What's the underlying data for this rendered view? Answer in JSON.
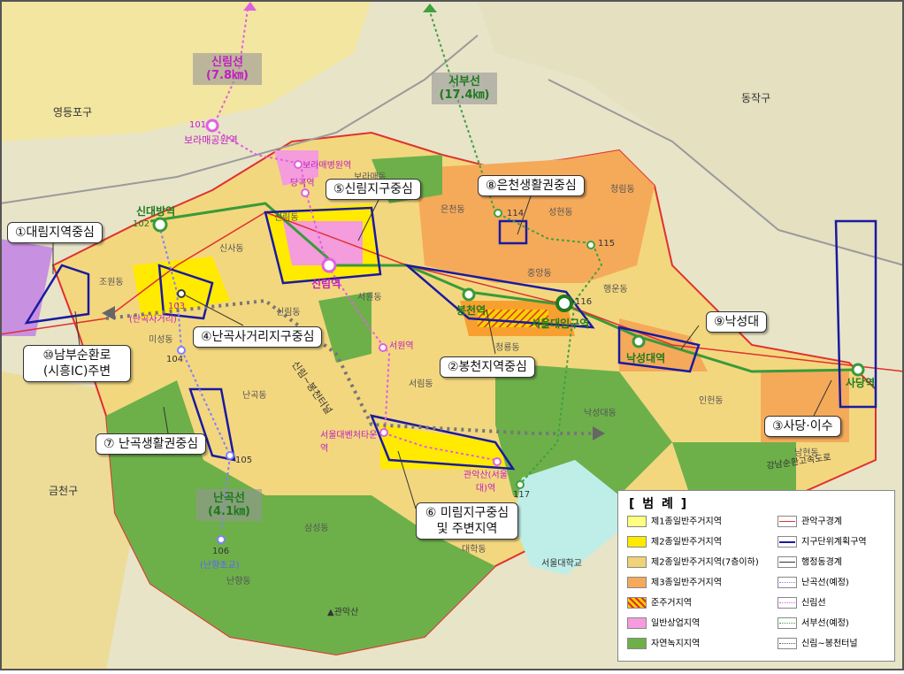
{
  "districts": {
    "yeongdeungpo": "영등포구",
    "dongjak": "동작구",
    "geumcheon": "금천구"
  },
  "neighborhoods": {
    "jowon": "조원동",
    "sinsa": "신사동",
    "sillim": "신림동",
    "seowon": "서원동",
    "misung": "미성동",
    "nangok": "난곡동",
    "seorim": "서림동",
    "nanhyang": "난향동",
    "samseong": "삼성동",
    "daehak": "대학동",
    "euncheon": "은천동",
    "seonghyeon": "성현동",
    "cheongrim": "청림동",
    "jungang": "중앙동",
    "haengun": "행운동",
    "cheongryong": "청룡동",
    "nakseongdae": "낙성대동",
    "inheon": "인헌동",
    "namhyeon": "남현동",
    "boramae": "보라매동"
  },
  "stations": {
    "sindaebang": "신대방역",
    "sillim": "신림역",
    "bongcheon": "봉천역",
    "snu": "서울대입구역",
    "nakseongdae": "낙성대역",
    "sadang": "사당역",
    "boramae_park": "보라매공원역",
    "boramae_hospital": "보라매병원역",
    "dang": "당곡역",
    "seowon": "서원역",
    "venture": "서울대벤처타운역",
    "gwanaksan": "관악산(서울대)역",
    "nangok_intersection": "(난곡사거리)",
    "nanhyang_school": "(난향초교)",
    "snu_campus": "서울대학교",
    "gwanaksan_peak": "▲관악산",
    "expressway": "강남순환고속도로",
    "tunnel_road": "신림~봉천터널"
  },
  "station_numbers": {
    "n101": "101",
    "n102": "102",
    "n103": "103",
    "n104": "104",
    "n105": "105",
    "n106": "106",
    "n114": "114",
    "n115": "115",
    "n116": "116",
    "n117": "117"
  },
  "line_labels": {
    "sillim_line": "신림선\n(7.8㎞)",
    "seobu_line": "서부선\n(17.4㎞)",
    "nangok_line": "난곡선\n(4.1㎞)"
  },
  "callouts": {
    "c1": "①대림지역중심",
    "c2": "②봉천지역중심",
    "c3": "③사당·이수",
    "c4": "④난곡사거리지구중심",
    "c5": "⑤신림지구중심",
    "c6": "⑥ 미림지구중심\n및 주변지역",
    "c7": "⑦ 난곡생활권중심",
    "c8": "⑧은천생활권중심",
    "c9": "⑨낙성대",
    "c10": "⑩남부순환로\n(시흥IC)주변"
  },
  "legend": {
    "title": "[ 범   례 ]",
    "items": [
      {
        "label": "제1종일반주거지역",
        "color": "#ffff80"
      },
      {
        "label": "제2종일반주거지역",
        "color": "#ffea00"
      },
      {
        "label": "제2종일반주거지역(7층이하)",
        "color": "#f0d278"
      },
      {
        "label": "제3종일반주거지역",
        "color": "#f5aa5a"
      },
      {
        "label": "준주거지역",
        "color": "#f7a030"
      },
      {
        "label": "일반상업지역",
        "color": "#f49cdc"
      },
      {
        "label": "자연녹지지역",
        "color": "#6db04a"
      }
    ],
    "lines": [
      {
        "label": "관악구경계",
        "color": "#e03030"
      },
      {
        "label": "지구단위계획구역",
        "color": "#1a1aa0"
      },
      {
        "label": "행정동경계",
        "color": "#333333"
      },
      {
        "label": "난곡선(예정)",
        "color": "#8080ff"
      },
      {
        "label": "신림선",
        "color": "#e060e0"
      },
      {
        "label": "서부선(예정)",
        "color": "#40a040"
      },
      {
        "label": "신림~봉천터널",
        "color": "#555555"
      }
    ]
  }
}
